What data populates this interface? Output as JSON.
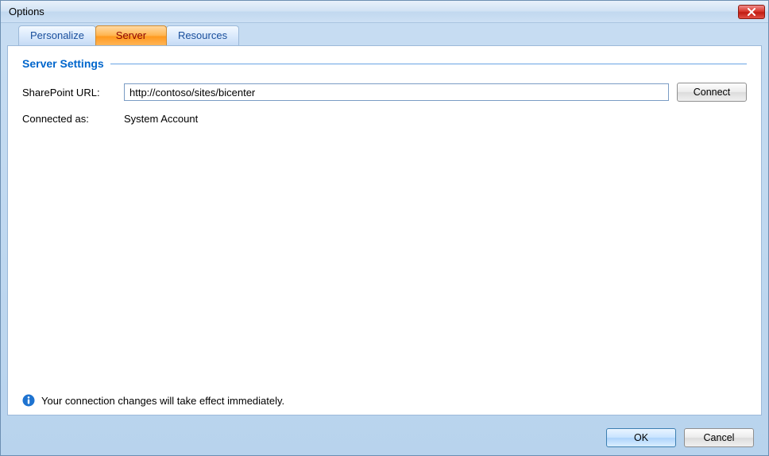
{
  "window": {
    "title": "Options"
  },
  "tabs": {
    "personalize": "Personalize",
    "server": "Server",
    "resources": "Resources"
  },
  "group": {
    "title": "Server Settings"
  },
  "form": {
    "sharepoint_label": "SharePoint URL:",
    "sharepoint_value": "http://contoso/sites/bicenter",
    "connect_label": "Connect",
    "connected_as_label": "Connected as:",
    "connected_as_value": "System Account"
  },
  "info": {
    "text": "Your connection changes will take effect immediately."
  },
  "footer": {
    "ok": "OK",
    "cancel": "Cancel"
  }
}
